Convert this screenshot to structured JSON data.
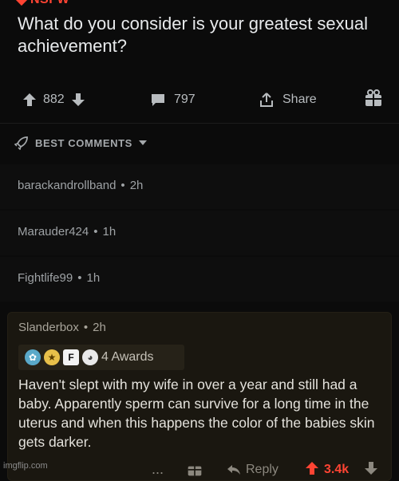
{
  "post": {
    "nsfw_label": "NSFW",
    "title": "What do you consider is your greatest sexual achievement?",
    "upvotes": "882",
    "comments": "797",
    "share_label": "Share"
  },
  "sort": {
    "label": "BEST COMMENTS"
  },
  "comments": [
    {
      "author": "barackandrollband",
      "age": "2h"
    },
    {
      "author": "Marauder424",
      "age": "1h"
    },
    {
      "author": "Fightlife99",
      "age": "1h"
    }
  ],
  "highlighted": {
    "author": "Slanderbox",
    "age": "2h",
    "awards_text": "4 Awards",
    "body": "Haven't slept with my wife in over a year and still had a baby. Apparently sperm can survive for a long time in the uterus and when this happens the color of the babies skin gets darker.",
    "reply_label": "Reply",
    "votes": "3.4k",
    "more_label": "..."
  },
  "watermark": "imgflip.com",
  "colors": {
    "accent": "#ff4433",
    "background": "#0b0b0b"
  }
}
